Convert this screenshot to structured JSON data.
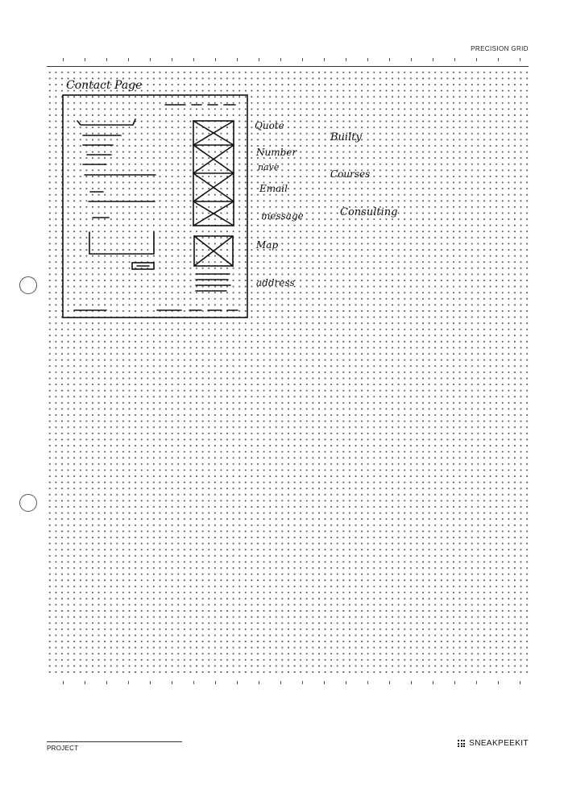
{
  "header": {
    "label": "PRECISION GRID"
  },
  "sketch": {
    "title": "Contact Page",
    "annotations": [
      "Quote",
      "Number",
      "nave",
      "Email",
      "message",
      "Map",
      "address"
    ],
    "notes": [
      "Builty",
      "Courses",
      "Consulting"
    ]
  },
  "footer": {
    "project_label": "PROJECT",
    "brand": "SNEAKPEEKIT"
  },
  "icons": {
    "binder_hole": "binder-hole",
    "brand_mark": "grid-dots-icon"
  }
}
